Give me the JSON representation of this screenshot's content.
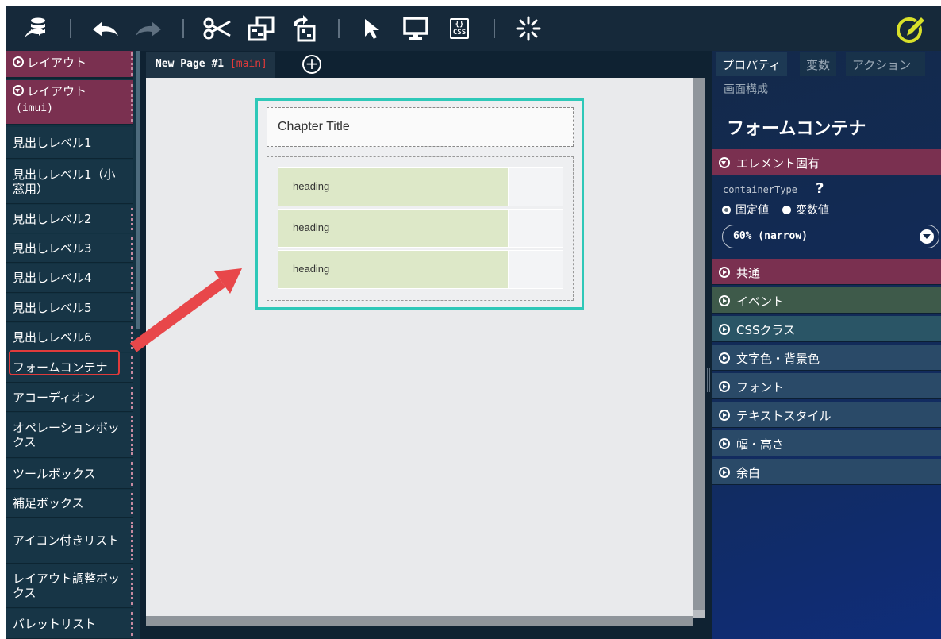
{
  "toolbar": {
    "icons": [
      "database-menu-icon",
      "undo-icon",
      "redo-icon",
      "cut-icon",
      "copy-icon",
      "paste-icon",
      "select-pointer-icon",
      "preview-monitor-icon",
      "css-icon",
      "loading-icon",
      "edit-pencil-icon"
    ],
    "css_icon_label": "CSS"
  },
  "sidebar": {
    "header1": "レイアウト",
    "header2_line1": "レイアウト",
    "header2_line2": "(imui)",
    "items": [
      "見出しレベル1",
      "見出しレベル1（小窓用）",
      "見出しレベル2",
      "見出しレベル3",
      "見出しレベル4",
      "見出しレベル5",
      "見出しレベル6",
      "フォームコンテナ",
      "アコーディオン",
      "オペレーションボックス",
      "ツールボックス",
      "補足ボックス",
      "アイコン付きリスト",
      "レイアウト調整ボックス",
      "バレットリスト"
    ],
    "selected_item": "フォームコンテナ"
  },
  "canvas": {
    "tab_label": "New Page #1",
    "tab_tag": "[main]",
    "add_tab_symbol": "+",
    "chapter_title": "Chapter Title",
    "headings": [
      "heading",
      "heading",
      "heading"
    ]
  },
  "panel": {
    "tabs": [
      "プロパティ",
      "変数",
      "アクション"
    ],
    "active_tab": "プロパティ",
    "subtab": "画面構成",
    "title": "フォームコンテナ",
    "sections": [
      {
        "label": "エレメント固有",
        "color": "#7a3050",
        "expanded": true
      },
      {
        "label": "共通",
        "color": "#7a3050",
        "expanded": false
      },
      {
        "label": "イベント",
        "color": "#3e5a4a",
        "expanded": false
      },
      {
        "label": "CSSクラス",
        "color": "#2a5566",
        "expanded": false
      },
      {
        "label": "文字色・背景色",
        "color": "#2a4a68",
        "expanded": false
      },
      {
        "label": "フォント",
        "color": "#2a4a68",
        "expanded": false
      },
      {
        "label": "テキストスタイル",
        "color": "#2a4a68",
        "expanded": false
      },
      {
        "label": "幅・高さ",
        "color": "#2a4a68",
        "expanded": false
      },
      {
        "label": "余白",
        "color": "#2a4a68",
        "expanded": false
      }
    ],
    "property_name": "containerType",
    "help_symbol": "?",
    "radio_fixed": "固定値",
    "radio_variable": "変数値",
    "selected_value": "60% (narrow)"
  },
  "colors": {
    "container_border": "#2ec8b8",
    "arrow": "#e8474a",
    "highlight": "#e03b3b",
    "sidebar_header": "#7a3050",
    "accent_pencil": "#d8e02a"
  }
}
